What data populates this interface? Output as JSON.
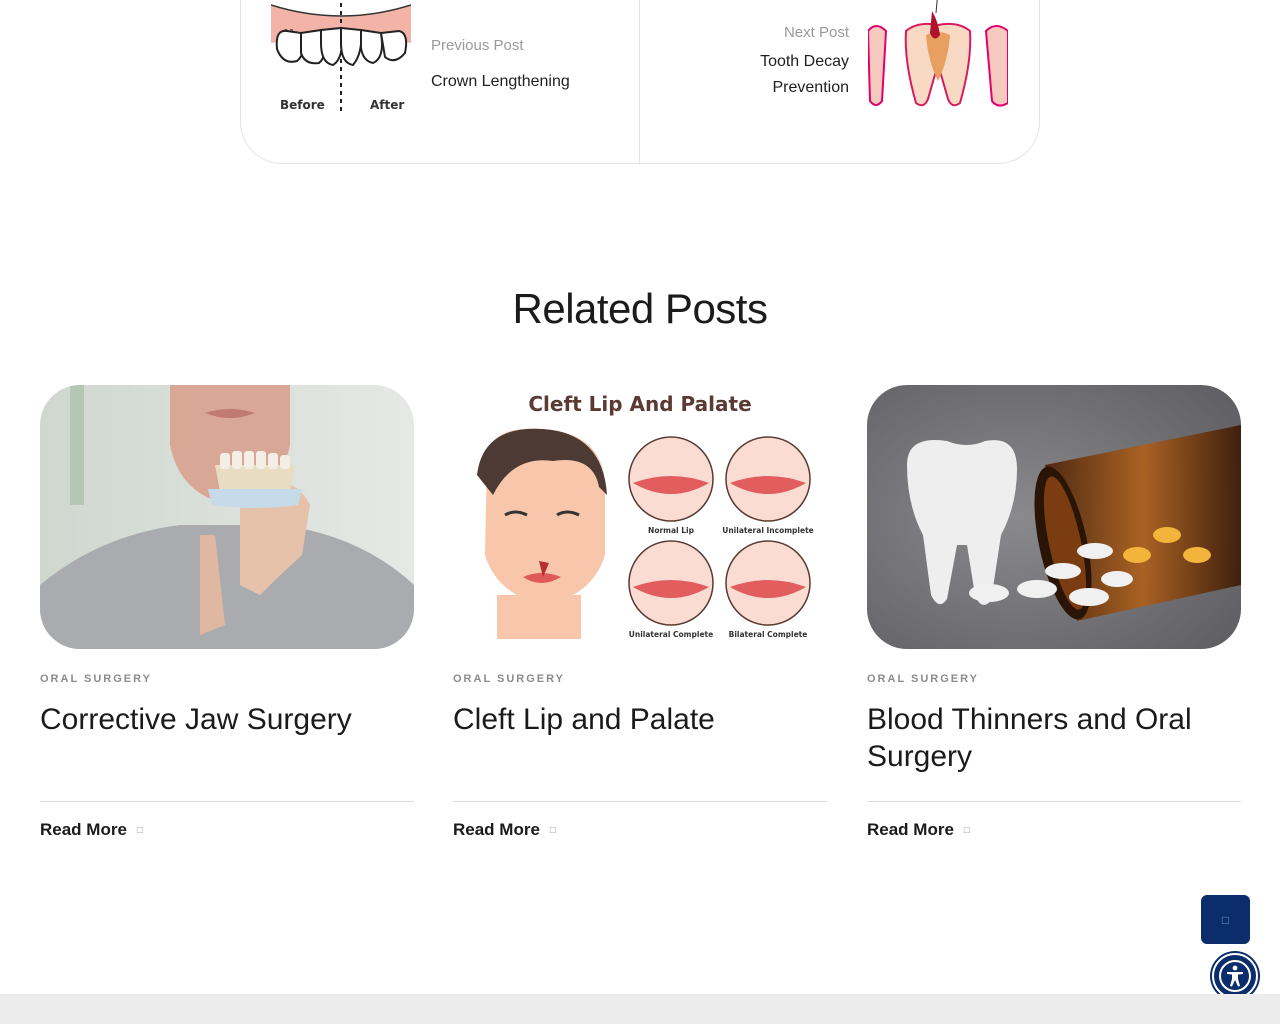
{
  "post_nav": {
    "previous": {
      "kicker": "Previous Post",
      "title": "Crown Lengthening",
      "image_labels": [
        "Before",
        "After"
      ]
    },
    "next": {
      "kicker": "Next Post",
      "title": "Tooth Decay Prevention"
    }
  },
  "related": {
    "heading": "Related Posts",
    "cards": [
      {
        "category": "ORAL SURGERY",
        "title": "Corrective Jaw Surgery",
        "read_more": "Read More"
      },
      {
        "category": "ORAL SURGERY",
        "title": "Cleft Lip and Palate",
        "read_more": "Read More",
        "image_text": {
          "title": "Cleft Lip And Palate",
          "labels": [
            "Normal Lip",
            "Unilateral Incomplete",
            "Unilateral Complete",
            "Bilateral Complete"
          ]
        }
      },
      {
        "category": "ORAL SURGERY",
        "title": "Blood Thinners and Oral Surgery",
        "read_more": "Read More"
      }
    ]
  },
  "floating": {
    "scroll_top_icon": "chevron-up-icon",
    "accessibility_icon": "accessibility-icon"
  },
  "colors": {
    "brand_navy": "#0b2d6b",
    "text": "#1b1b1b",
    "muted": "#8c8c8c"
  }
}
